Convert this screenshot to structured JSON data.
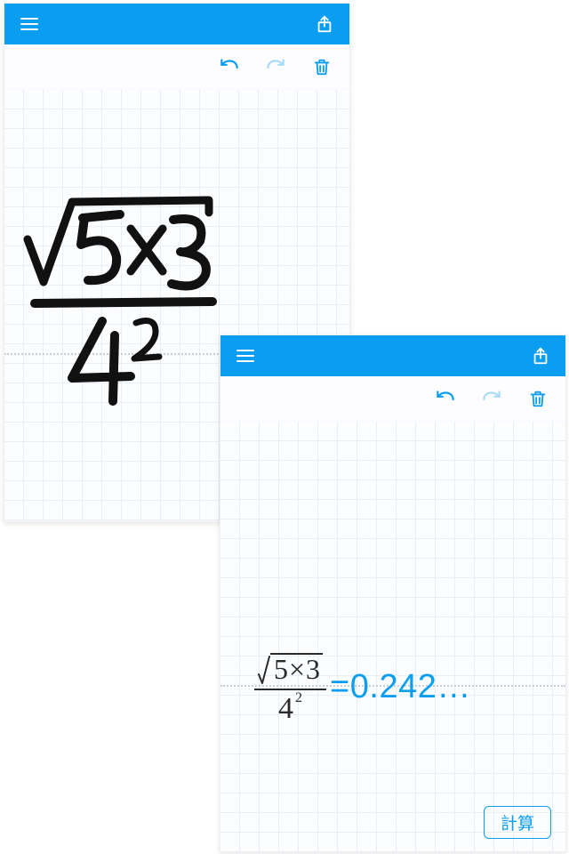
{
  "colors": {
    "accent": "#0a9df0",
    "ink": "#2a2a2a"
  },
  "icons": {
    "menu": "menu-icon",
    "share": "share-icon",
    "undo": "undo-icon",
    "redo": "redo-icon",
    "trash": "trash-icon"
  },
  "shot1": {
    "handwriting": {
      "numerator_inside_sqrt": "5×3",
      "denominator_base": "4",
      "denominator_exponent": "2"
    }
  },
  "shot2": {
    "expression": {
      "radicand_a": "5",
      "radicand_op": "×",
      "radicand_b": "3",
      "denominator_base": "4",
      "denominator_exponent": "2"
    },
    "equals": "=",
    "result": "0.242…",
    "calc_button": "計算"
  }
}
